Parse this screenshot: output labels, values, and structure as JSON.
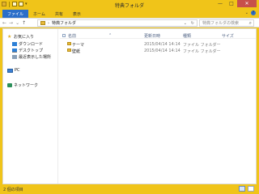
{
  "window": {
    "title": "特典フォルダ",
    "controls": {
      "minimize": "—",
      "maximize": "□",
      "close": "✕"
    }
  },
  "ribbon": {
    "tabs": [
      {
        "label": "ファイル",
        "active": true
      },
      {
        "label": "ホーム"
      },
      {
        "label": "共有"
      },
      {
        "label": "表示"
      }
    ],
    "expand_glyph": "⌄",
    "help_glyph": "?"
  },
  "address_bar": {
    "nav": {
      "back": "←",
      "forward": "→",
      "recent": "⌄",
      "up": "↑"
    },
    "separator": "›",
    "current": "特典フォルダ",
    "dropdown_glyph": "⌄",
    "refresh_glyph": "↻",
    "search_placeholder": "特典フォルダの検索",
    "search_glyph": "⌕"
  },
  "sidebar": {
    "favorites": "お気に入り",
    "items": [
      {
        "label": "ダウンロード",
        "icon": "download-icon"
      },
      {
        "label": "デスクトップ",
        "icon": "desktop-icon"
      },
      {
        "label": "最近表示した場所",
        "icon": "recent-places-icon"
      }
    ],
    "pc": "PC",
    "network": "ネットワーク"
  },
  "columns": {
    "name": "名前",
    "date": "更新日時",
    "type": "種類",
    "size": "サイズ"
  },
  "rows": [
    {
      "name": "テーマ",
      "date": "2015/04/14 14:14",
      "type": "ファイル フォルダー"
    },
    {
      "name": "壁紙",
      "date": "2015/04/14 14:14",
      "type": "ファイル フォルダー"
    }
  ],
  "status": {
    "item_count": "2 個の項目"
  },
  "colors": {
    "accent": "#f0c419",
    "file_tab": "#2b6ec9",
    "close": "#c7504b"
  }
}
